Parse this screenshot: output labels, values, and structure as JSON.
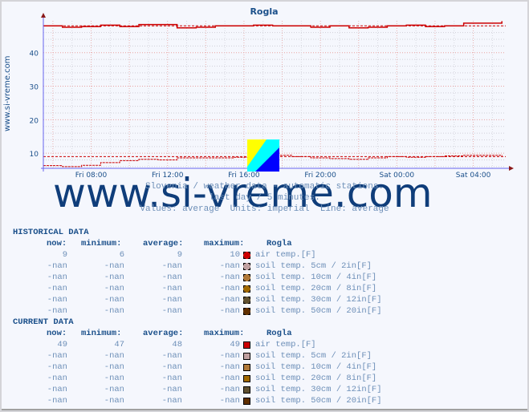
{
  "chart_data": {
    "type": "line",
    "title": "Rogla",
    "xlabel": "",
    "ylabel": "",
    "side_label": "www.si-vreme.com",
    "ylim": [
      5.5,
      49.5
    ],
    "yticks": [
      10,
      20,
      30,
      40
    ],
    "xlim_hours": [
      5.5,
      29.7
    ],
    "xticks": [
      {
        "hour": 8,
        "label": "Fri 08:00"
      },
      {
        "hour": 12,
        "label": "Fri 12:00"
      },
      {
        "hour": 16,
        "label": "Fri 16:00"
      },
      {
        "hour": 20,
        "label": "Fri 20:00"
      },
      {
        "hour": 24,
        "label": "Sat 00:00"
      },
      {
        "hour": 28,
        "label": "Sat 04:00"
      }
    ],
    "grid": true,
    "series": [
      {
        "name": "air temp.[F] (current)",
        "color": "#cc0000",
        "style": "solid",
        "average_line": 48,
        "hours": [
          5.5,
          6.5,
          7.5,
          8.5,
          9.5,
          10.5,
          11.5,
          12.5,
          13.5,
          14.5,
          15.5,
          16.5,
          17.5,
          18.5,
          19.5,
          20.5,
          21.5,
          22.5,
          23.5,
          24.5,
          25.5,
          26.5,
          27.5,
          28.5,
          29.5
        ],
        "values": [
          48,
          47.6,
          47.8,
          48.2,
          47.8,
          48.4,
          48.4,
          47.4,
          47.6,
          48,
          48,
          48.2,
          48,
          48,
          47.6,
          48,
          47.4,
          47.6,
          48,
          48.2,
          47.8,
          48,
          48.8,
          48.8,
          49.4
        ]
      },
      {
        "name": "air temp.[F] (historical)",
        "color": "#cc0000",
        "style": "dashed",
        "average_line": 9,
        "hours": [
          5.5,
          6.5,
          7.5,
          8.5,
          9.5,
          10.5,
          11.5,
          12.5,
          13.5,
          14.5,
          15.5,
          16.5,
          17.5,
          18.5,
          19.5,
          20.5,
          21.5,
          22.5,
          23.5,
          24.5,
          25.5,
          26.5,
          27.5,
          28.5,
          29.5
        ],
        "values": [
          6.3,
          6,
          6.4,
          7.2,
          7.8,
          8.2,
          8,
          8.6,
          8.6,
          8.6,
          8.8,
          9.2,
          9.4,
          9,
          8.6,
          8.4,
          8.2,
          8.6,
          9,
          8.8,
          9,
          9.2,
          9.4,
          9.4,
          9.2
        ]
      }
    ]
  },
  "watermark": "www.si-vreme.com",
  "subtitle_lines": [
    "Slovenia / weather data - automatic stations.",
    "last day / 5 minutes.",
    "Values: average  Units: imperial  Line: average"
  ],
  "table_headers": {
    "now": "now:",
    "minimum": "minimum:",
    "average": "average:",
    "maximum": "maximum:",
    "station": "Rogla"
  },
  "historical": {
    "title": "HISTORICAL DATA",
    "rows": [
      {
        "now": "9",
        "min": "6",
        "avg": "9",
        "max": "10",
        "label": "air temp.[F]",
        "color": "#cc0000"
      },
      {
        "now": "-nan",
        "min": "-nan",
        "avg": "-nan",
        "max": "-nan",
        "label": "soil temp. 5cm / 2in[F]",
        "color": "#c0a0a0"
      },
      {
        "now": "-nan",
        "min": "-nan",
        "avg": "-nan",
        "max": "-nan",
        "label": "soil temp. 10cm / 4in[F]",
        "color": "#b07838"
      },
      {
        "now": "-nan",
        "min": "-nan",
        "avg": "-nan",
        "max": "-nan",
        "label": "soil temp. 20cm / 8in[F]",
        "color": "#a06800"
      },
      {
        "now": "-nan",
        "min": "-nan",
        "avg": "-nan",
        "max": "-nan",
        "label": "soil temp. 30cm / 12in[F]",
        "color": "#605030"
      },
      {
        "now": "-nan",
        "min": "-nan",
        "avg": "-nan",
        "max": "-nan",
        "label": "soil temp. 50cm / 20in[F]",
        "color": "#603000"
      }
    ]
  },
  "current": {
    "title": "CURRENT DATA",
    "rows": [
      {
        "now": "49",
        "min": "47",
        "avg": "48",
        "max": "49",
        "label": "air temp.[F]",
        "color": "#cc0000"
      },
      {
        "now": "-nan",
        "min": "-nan",
        "avg": "-nan",
        "max": "-nan",
        "label": "soil temp. 5cm / 2in[F]",
        "color": "#c0a0a0"
      },
      {
        "now": "-nan",
        "min": "-nan",
        "avg": "-nan",
        "max": "-nan",
        "label": "soil temp. 10cm / 4in[F]",
        "color": "#b07838"
      },
      {
        "now": "-nan",
        "min": "-nan",
        "avg": "-nan",
        "max": "-nan",
        "label": "soil temp. 20cm / 8in[F]",
        "color": "#a06800"
      },
      {
        "now": "-nan",
        "min": "-nan",
        "avg": "-nan",
        "max": "-nan",
        "label": "soil temp. 30cm / 12in[F]",
        "color": "#605030"
      },
      {
        "now": "-nan",
        "min": "-nan",
        "avg": "-nan",
        "max": "-nan",
        "label": "soil temp. 50cm / 20in[F]",
        "color": "#603000"
      }
    ]
  }
}
